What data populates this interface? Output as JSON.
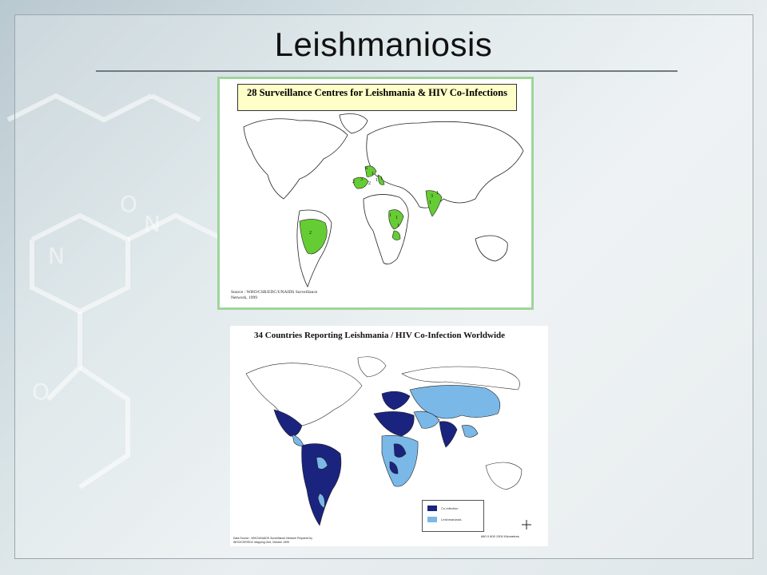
{
  "slide": {
    "title": "Leishmaniosis"
  },
  "map_top": {
    "banner_title": "28 Surveillance Centres for Leishmania & HIV Co-Infections",
    "source_text": "Source : WHO/CSR/EDC/UNAIDS Surveillance Network, 1999",
    "highlight_color": "#66cc33",
    "markers": [
      {
        "label": "6"
      },
      {
        "label": "1"
      },
      {
        "label": "2"
      },
      {
        "label": "3"
      },
      {
        "label": "1"
      },
      {
        "label": "2"
      },
      {
        "label": "1"
      },
      {
        "label": "1"
      },
      {
        "label": "1"
      },
      {
        "label": "1"
      },
      {
        "label": "3"
      },
      {
        "label": "1"
      },
      {
        "label": "1"
      },
      {
        "label": "2"
      }
    ]
  },
  "map_bottom": {
    "title": "34 Countries Reporting Leishmania / HIV Co-Infection Worldwide",
    "legend": [
      {
        "label": "Co-infection",
        "color": "#1a237e"
      },
      {
        "label": "Leishmaniasis",
        "color": "#7ab8e8"
      }
    ],
    "scale_text": "680  0  600 1300  Kilometres",
    "footnote": "Data Source : WHO/UNAIDS Surveillance Network Prepared by WHO/CSR/EDC Mapping Unit, October 1999"
  },
  "colors": {
    "coinfection": "#1a237e",
    "leishmaniasis": "#7ab8e8",
    "map1_border": "#9fd59a",
    "banner_bg": "#fefec8"
  }
}
